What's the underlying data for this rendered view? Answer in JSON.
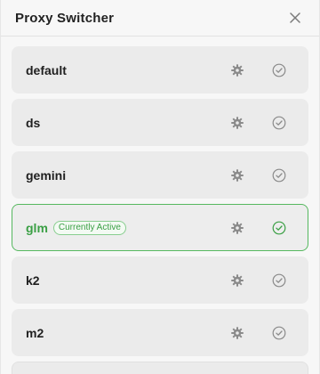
{
  "window": {
    "title": "Proxy Switcher"
  },
  "icons": {
    "close": "close-icon",
    "settings": "gear-icon",
    "select": "check-circle-icon"
  },
  "colors": {
    "accent": "#3a9f44",
    "active_border": "#56b85f",
    "row_bg": "#ebebeb",
    "icon_gray": "#8a8a8a"
  },
  "proxies": [
    {
      "name": "default",
      "active": false
    },
    {
      "name": "ds",
      "active": false
    },
    {
      "name": "gemini",
      "active": false
    },
    {
      "name": "glm",
      "active": true,
      "badge": "Currently Active"
    },
    {
      "name": "k2",
      "active": false
    },
    {
      "name": "m2",
      "active": false
    }
  ]
}
